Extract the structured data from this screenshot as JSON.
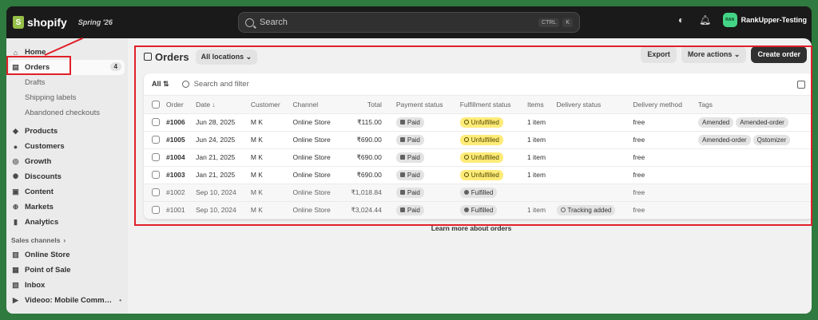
{
  "topbar": {
    "logo_glyph": "S",
    "brand": "shopify",
    "edition": "Spring '26",
    "search_placeholder": "Search",
    "kbd_ctrl": "CTRL",
    "kbd_k": "K",
    "store_initials": "RAN",
    "store_name": "RankUpper-Testing"
  },
  "sidebar": {
    "home": "Home",
    "orders": "Orders",
    "orders_count": "4",
    "drafts": "Drafts",
    "shipping_labels": "Shipping labels",
    "abandoned_checkouts": "Abandoned checkouts",
    "products": "Products",
    "customers": "Customers",
    "growth": "Growth",
    "discounts": "Discounts",
    "content": "Content",
    "markets": "Markets",
    "analytics": "Analytics",
    "sales_channels": "Sales channels",
    "online_store": "Online Store",
    "point_of_sale": "Point of Sale",
    "inbox": "Inbox",
    "videoo": "Videoo: Mobile Comm…"
  },
  "main": {
    "title": "Orders",
    "location_filter": "All locations",
    "export": "Export",
    "more_actions": "More actions",
    "create_order": "Create order",
    "all_tab": "All",
    "search_filter_placeholder": "Search and filter",
    "learn_more": "Learn more about orders"
  },
  "table": {
    "headers": {
      "order": "Order",
      "date": "Date ↓",
      "customer": "Customer",
      "channel": "Channel",
      "total": "Total",
      "payment_status": "Payment status",
      "fulfillment_status": "Fulfillment status",
      "items": "Items",
      "delivery_status": "Delivery status",
      "delivery_method": "Delivery method",
      "tags": "Tags"
    },
    "rows": [
      {
        "order": "#1006",
        "date": "Jun 28, 2025",
        "customer": "M K",
        "channel": "Online Store",
        "total": "₹115.00",
        "payment": "Paid",
        "fulfillment": "Unfulfilled",
        "items": "1 item",
        "delivery_status": "",
        "delivery_method": "free",
        "tag1": "Amended",
        "tag2": "Amended-order"
      },
      {
        "order": "#1005",
        "date": "Jun 24, 2025",
        "customer": "M K",
        "channel": "Online Store",
        "total": "₹690.00",
        "payment": "Paid",
        "fulfillment": "Unfulfilled",
        "items": "1 item",
        "delivery_status": "",
        "delivery_method": "free",
        "tag1": "Amended-order",
        "tag2": "Qstomizer"
      },
      {
        "order": "#1004",
        "date": "Jan 21, 2025",
        "customer": "M K",
        "channel": "Online Store",
        "total": "₹690.00",
        "payment": "Paid",
        "fulfillment": "Unfulfilled",
        "items": "1 item",
        "delivery_status": "",
        "delivery_method": "free",
        "tag1": "",
        "tag2": ""
      },
      {
        "order": "#1003",
        "date": "Jan 21, 2025",
        "customer": "M K",
        "channel": "Online Store",
        "total": "₹690.00",
        "payment": "Paid",
        "fulfillment": "Unfulfilled",
        "items": "1 item",
        "delivery_status": "",
        "delivery_method": "free",
        "tag1": "",
        "tag2": ""
      },
      {
        "order": "#1002",
        "date": "Sep 10, 2024",
        "customer": "M K",
        "channel": "Online Store",
        "total": "₹1,018.84",
        "payment": "Paid",
        "fulfillment": "Fulfilled",
        "items": "",
        "delivery_status": "",
        "delivery_method": "free",
        "tag1": "",
        "tag2": ""
      },
      {
        "order": "#1001",
        "date": "Sep 10, 2024",
        "customer": "M K",
        "channel": "Online Store",
        "total": "₹3,024.44",
        "payment": "Paid",
        "fulfillment": "Fulfilled",
        "items": "1 item",
        "delivery_status": "Tracking added",
        "delivery_method": "free",
        "tag1": "",
        "tag2": ""
      }
    ]
  }
}
